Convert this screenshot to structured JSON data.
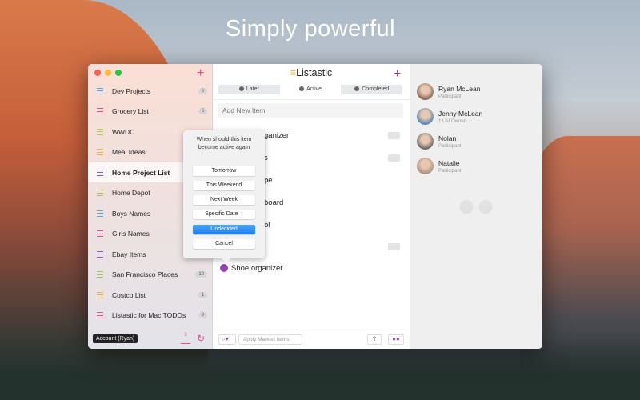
{
  "headline": "Simply powerful",
  "sidebar": {
    "items": [
      {
        "label": "Dev Projects",
        "count": "6",
        "color": "#4aa8e0"
      },
      {
        "label": "Grocery List",
        "count": "6",
        "color": "#e0508a"
      },
      {
        "label": "WWDC",
        "count": null,
        "color": "#b8c840"
      },
      {
        "label": "Meal Ideas",
        "count": null,
        "color": "#f0b030"
      },
      {
        "label": "Home Project List",
        "count": null,
        "color": "#8a5ab0",
        "selected": true
      },
      {
        "label": "Home Depot",
        "count": null,
        "color": "#a8c050"
      },
      {
        "label": "Boys Names",
        "count": null,
        "color": "#4aa8e0"
      },
      {
        "label": "Girls Names",
        "count": null,
        "color": "#e0508a"
      },
      {
        "label": "Ebay Items",
        "count": null,
        "color": "#8a5ab0"
      },
      {
        "label": "San Francisco Places",
        "count": "10",
        "color": "#a8c050"
      },
      {
        "label": "Costco List",
        "count": "1",
        "color": "#f0b030"
      },
      {
        "label": "Listastic for Mac TODOs",
        "count": "8",
        "color": "#e0508a"
      }
    ],
    "account_label": "Account (Ryan)",
    "inbox_count": "3"
  },
  "main": {
    "title": "Listastic",
    "tabs": [
      {
        "label": "Later"
      },
      {
        "label": "Active"
      },
      {
        "label": "Completed"
      }
    ],
    "add_placeholder": "Add New Item",
    "items": [
      "ganizer",
      "s",
      "pe",
      "board",
      "ol",
      "",
      "Shoe organizer"
    ],
    "apply_label": "Apply Marked Items",
    "more_label": "···"
  },
  "popover": {
    "question": "When should this item become active again",
    "options": [
      "Tomorrow",
      "This Weekend",
      "Next Week",
      "Specific Date",
      "Undecided",
      "Cancel"
    ],
    "chevron": "›"
  },
  "participants": [
    {
      "name": "Ryan McLean",
      "role": "Participant",
      "color": "#8a6a58"
    },
    {
      "name": "Jenny McLean",
      "role": "† List Owner",
      "color": "#5a88b8"
    },
    {
      "name": "Nolan",
      "role": "Participant",
      "color": "#6a6a70"
    },
    {
      "name": "Natalie",
      "role": "Participant",
      "color": "#b09080"
    }
  ],
  "accent": "#8e44ad"
}
